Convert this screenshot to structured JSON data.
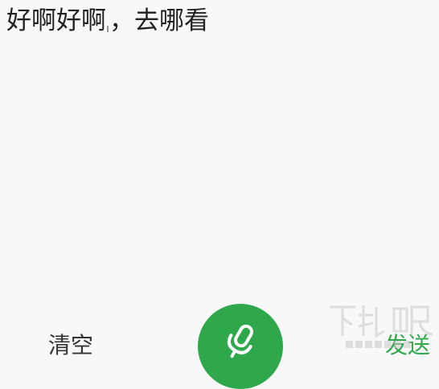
{
  "transcript": {
    "text_before_cursor": "好啊好啊",
    "text_after_cursor": "，去哪看"
  },
  "actions": {
    "clear_label": "清空",
    "send_label": "发送"
  },
  "mic": {
    "icon": "microphone-icon"
  },
  "watermark": {
    "logo": "download-site-logo",
    "text": "下载吧"
  },
  "colors": {
    "accent": "#2fa84b",
    "background": "#f8f8f8",
    "text": "#222222"
  }
}
